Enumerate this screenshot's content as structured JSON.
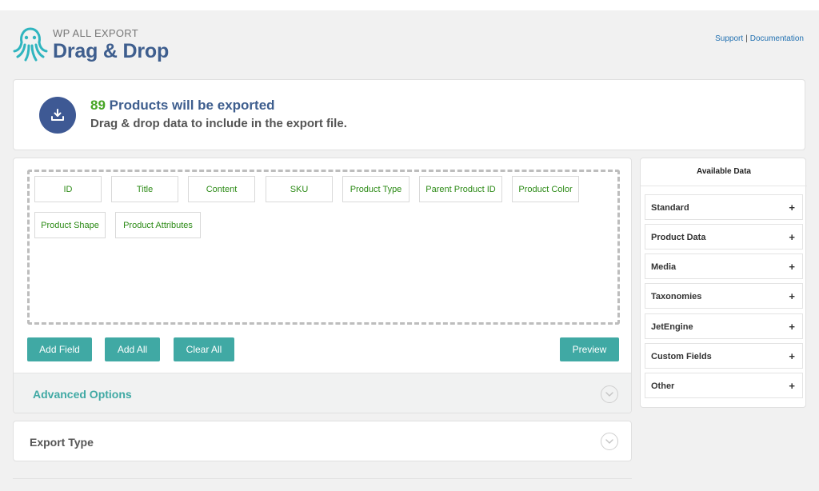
{
  "brand": {
    "small_title": "WP ALL EXPORT",
    "big_title": "Drag & Drop",
    "logo_icon": "octopus-logo-icon",
    "accent_color": "#40a9a4",
    "logo_color": "#2fb5bf"
  },
  "header_links": {
    "support": "Support",
    "separator": "|",
    "documentation": "Documentation"
  },
  "summary": {
    "icon": "download-icon",
    "count": "89",
    "count_suffix": "Products will be exported",
    "subtitle": "Drag & drop data to include in the export file.",
    "count_color": "#46a524",
    "title_color": "#3e5e8e"
  },
  "fields": [
    "ID",
    "Title",
    "Content",
    "SKU",
    "Product Type",
    "Parent Product ID",
    "Product Color",
    "Product Shape",
    "Product Attributes"
  ],
  "buttons": {
    "add_field": "Add Field",
    "add_all": "Add All",
    "clear_all": "Clear All",
    "preview": "Preview"
  },
  "advanced_options": {
    "label": "Advanced Options",
    "icon": "chevron-down-icon"
  },
  "export_type": {
    "label": "Export Type",
    "icon": "chevron-down-icon"
  },
  "available_data": {
    "title": "Available Data",
    "items": [
      {
        "label": "Standard",
        "icon": "+"
      },
      {
        "label": "Product Data",
        "icon": "+"
      },
      {
        "label": "Media",
        "icon": "+"
      },
      {
        "label": "Taxonomies",
        "icon": "+"
      },
      {
        "label": "JetEngine",
        "icon": "+"
      },
      {
        "label": "Custom Fields",
        "icon": "+"
      },
      {
        "label": "Other",
        "icon": "+"
      }
    ]
  }
}
